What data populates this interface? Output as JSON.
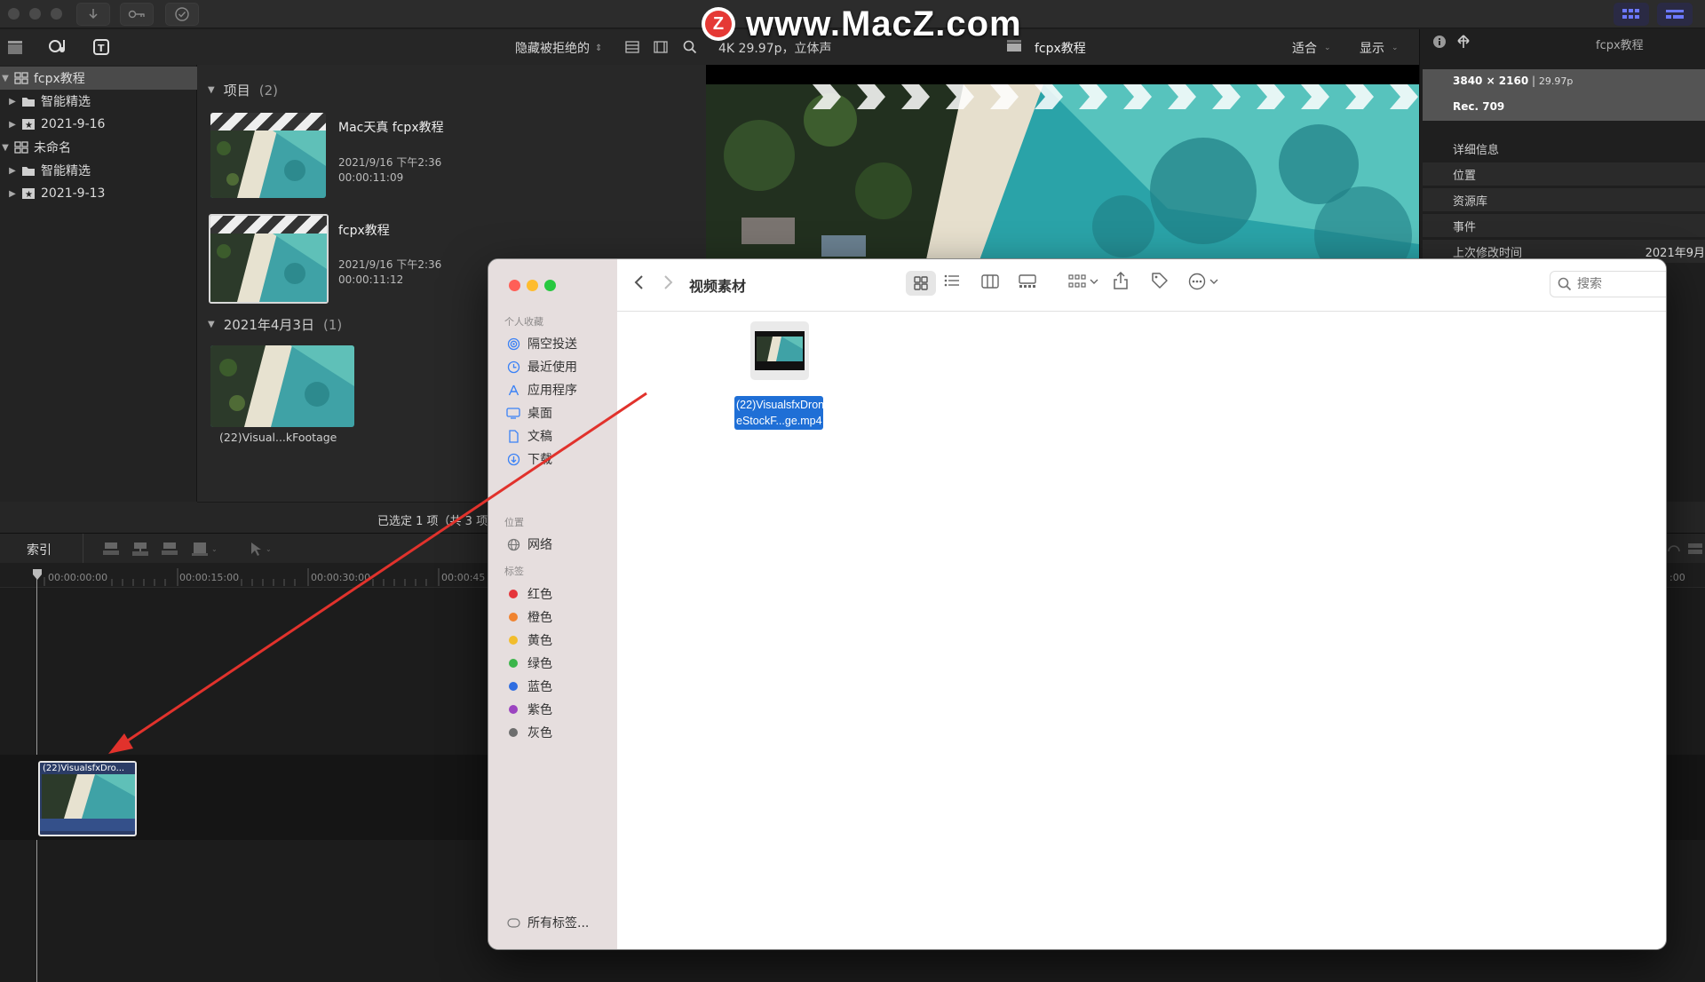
{
  "watermark": {
    "logo_letter": "Z",
    "text": "www.MacZ.com"
  },
  "library": {
    "items": [
      {
        "label": "fcpx教程",
        "kind": "library",
        "expanded": true,
        "selected": true,
        "indent": 0
      },
      {
        "label": "智能精选",
        "kind": "folder",
        "expanded": false,
        "indent": 1
      },
      {
        "label": "2021-9-16",
        "kind": "event",
        "expanded": false,
        "indent": 1
      },
      {
        "label": "未命名",
        "kind": "library",
        "expanded": true,
        "indent": 0
      },
      {
        "label": "智能精选",
        "kind": "folder",
        "expanded": false,
        "indent": 1
      },
      {
        "label": "2021-9-13",
        "kind": "event",
        "expanded": false,
        "indent": 1
      }
    ]
  },
  "browser": {
    "filter_label": "隐藏被拒绝的",
    "projects_section": {
      "label": "项目",
      "count": "(2)"
    },
    "projects": [
      {
        "title": "Mac天真 fcpx教程",
        "date": "2021/9/16 下午2:36",
        "duration": "00:00:11:09"
      },
      {
        "title": "fcpx教程",
        "date": "2021/9/16 下午2:36",
        "duration": "00:00:11:12"
      }
    ],
    "date_section": {
      "label": "2021年4月3日",
      "count": "(1)"
    },
    "clip_label": "(22)Visual...kFootage",
    "footer_status": "已选定 1 项（共 3 项）"
  },
  "viewer": {
    "format": "4K 29.97p，立体声",
    "project_name": "fcpx教程",
    "fit_label": "适合",
    "display_label": "显示"
  },
  "inspector": {
    "title": "fcpx教程",
    "resolution": "3840 × 2160",
    "framerate": "29.97p",
    "color": "Rec. 709",
    "details_label": "详细信息",
    "rows": [
      "位置",
      "资源库",
      "事件",
      "上次修改时间"
    ],
    "modified_value": "2021年9月"
  },
  "timeline": {
    "index_label": "索引",
    "ruler": [
      "00:00:00:00",
      "00:00:15:00",
      "00:00:30:00",
      "00:00:45"
    ],
    "ruler_right": ":00",
    "clip_label": "(22)VisualsfxDro..."
  },
  "finder": {
    "title": "视频素材",
    "search_placeholder": "搜索",
    "sections": {
      "favorites": "个人收藏",
      "locations": "位置",
      "tags": "标签"
    },
    "favorites": [
      {
        "label": "隔空投送",
        "icon": "airdrop-icon"
      },
      {
        "label": "最近使用",
        "icon": "recents-icon"
      },
      {
        "label": "应用程序",
        "icon": "applications-icon"
      },
      {
        "label": "桌面",
        "icon": "desktop-icon"
      },
      {
        "label": "文稿",
        "icon": "documents-icon"
      },
      {
        "label": "下载",
        "icon": "downloads-icon"
      }
    ],
    "locations": [
      {
        "label": "网络",
        "icon": "network-icon"
      }
    ],
    "tags": [
      {
        "label": "红色",
        "color": "#e5343a"
      },
      {
        "label": "橙色",
        "color": "#f0832f"
      },
      {
        "label": "黄色",
        "color": "#f2bd2c"
      },
      {
        "label": "绿色",
        "color": "#3bb54a"
      },
      {
        "label": "蓝色",
        "color": "#2f6de1"
      },
      {
        "label": "紫色",
        "color": "#9b44c0"
      },
      {
        "label": "灰色",
        "color": "#6d6d6d"
      }
    ],
    "all_tags": "所有标签...",
    "file": {
      "label_line1": "(22)VisualsfxDron",
      "label_line2": "eStockF...ge.mp4"
    }
  },
  "colors": {
    "accent_blue": "#1f6fd6",
    "arrow_red": "#e1322c",
    "selection_gray": "#4a4a4a"
  }
}
